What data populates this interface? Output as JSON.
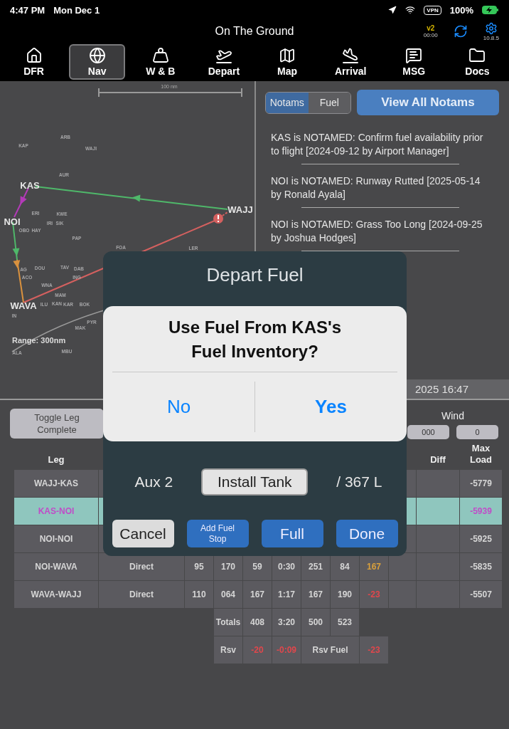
{
  "status_bar": {
    "time": "4:47 PM",
    "date": "Mon Dec 1",
    "vpn": "VPN",
    "battery": "100%"
  },
  "header": {
    "title": "On The Ground",
    "version_badge": "v2",
    "timer": "00:00",
    "app_version": "10.8.5"
  },
  "tabs": [
    {
      "label": "DFR",
      "selected": false
    },
    {
      "label": "Nav",
      "selected": true
    },
    {
      "label": "W & B",
      "selected": false
    },
    {
      "label": "Depart",
      "selected": false
    },
    {
      "label": "Map",
      "selected": false
    },
    {
      "label": "Arrival",
      "selected": false
    },
    {
      "label": "MSG",
      "selected": false
    },
    {
      "label": "Docs",
      "selected": false
    }
  ],
  "map": {
    "scale": "100 nm",
    "range": "Range: 300nm",
    "airports": [
      "KAS",
      "NOI",
      "WAJJ",
      "WAVA"
    ],
    "waypoints": [
      "ARB",
      "KAP",
      "WAJI",
      "AUR",
      "ERI",
      "KWE",
      "IRI",
      "SIK",
      "OBO",
      "HAY",
      "PAP",
      "FOA",
      "LER",
      "AG",
      "DOU",
      "TAV",
      "DAB",
      "ACO",
      "ING",
      "WNA",
      "MAM",
      "ILU",
      "KAN",
      "KAR",
      "BOK",
      "IN",
      "PYR",
      "MAK",
      "ALA",
      "MBU"
    ]
  },
  "notams_panel": {
    "segments": [
      {
        "label": "Notams",
        "selected": true
      },
      {
        "label": "Fuel",
        "selected": false
      }
    ],
    "view_all_button": "View All Notams",
    "notams": [
      "KAS is NOTAMED: Confirm fuel availability prior to flight [2024-09-12 by Airport Manager]",
      "NOI is NOTAMED: Runway Rutted [2025-05-14 by Ronald Ayala]",
      "NOI is NOTAMED: Grass Too Long [2024-09-25 by Joshua Hodges]"
    ],
    "date_bar": "2025 16:47"
  },
  "leg_controls": {
    "toggle_button": "Toggle Leg Complete",
    "wind_label": "Wind",
    "wind_fields": [
      "000",
      "0"
    ]
  },
  "table": {
    "columns": {
      "leg": "Leg",
      "diff": "Diff",
      "max_load": "Max Load"
    },
    "rows": [
      {
        "leg": "WAJJ-KAS",
        "selected": false,
        "max_load": "-5779"
      },
      {
        "leg": "KAS-NOI",
        "selected": true,
        "max_load": "-5939"
      },
      {
        "leg": "NOI-NOI",
        "selected": false,
        "max_load": "-5925"
      },
      {
        "leg": "NOI-WAVA",
        "selected": false,
        "route": "Direct",
        "cells": [
          {
            "text": "95"
          },
          {
            "text": "170"
          },
          {
            "text": "59"
          },
          {
            "text": "0:30"
          },
          {
            "text": "251"
          },
          {
            "text": "84"
          },
          {
            "text": "167",
            "color": "#d9a03c"
          }
        ],
        "max_load": "-5835"
      },
      {
        "leg": "WAVA-WAJJ",
        "selected": false,
        "route": "Direct",
        "cells": [
          {
            "text": "110"
          },
          {
            "text": "064"
          },
          {
            "text": "167"
          },
          {
            "text": "1:17"
          },
          {
            "text": "167"
          },
          {
            "text": "190"
          },
          {
            "text": "-23",
            "color": "#e0474c"
          }
        ],
        "max_load": "-5507"
      }
    ],
    "totals": {
      "label": "Totals",
      "values": [
        "408",
        "3:20",
        "500",
        "523"
      ]
    },
    "reserve": {
      "label": "Rsv",
      "values": [
        {
          "text": "-20",
          "color": "#e0474c"
        },
        {
          "text": "-0:09",
          "color": "#e0474c"
        }
      ],
      "fuel_label": "Rsv Fuel",
      "fuel_value": {
        "text": "-23",
        "color": "#e0474c"
      }
    }
  },
  "fuel_dialog": {
    "title": "Depart Fuel",
    "tank_label": "Aux 2",
    "install_button": "Install Tank",
    "capacity": "/ 367 L",
    "buttons": [
      {
        "label": "Cancel",
        "kind": "secondary"
      },
      {
        "label": "Add Fuel Stop",
        "kind": "small"
      },
      {
        "label": "Full",
        "kind": "primary"
      },
      {
        "label": "Done",
        "kind": "primary"
      }
    ]
  },
  "alert": {
    "title": "Use Fuel From KAS's Fuel Inventory?",
    "buttons": [
      {
        "label": "No",
        "kind": "default"
      },
      {
        "label": "Yes",
        "kind": "preferred"
      }
    ]
  }
}
